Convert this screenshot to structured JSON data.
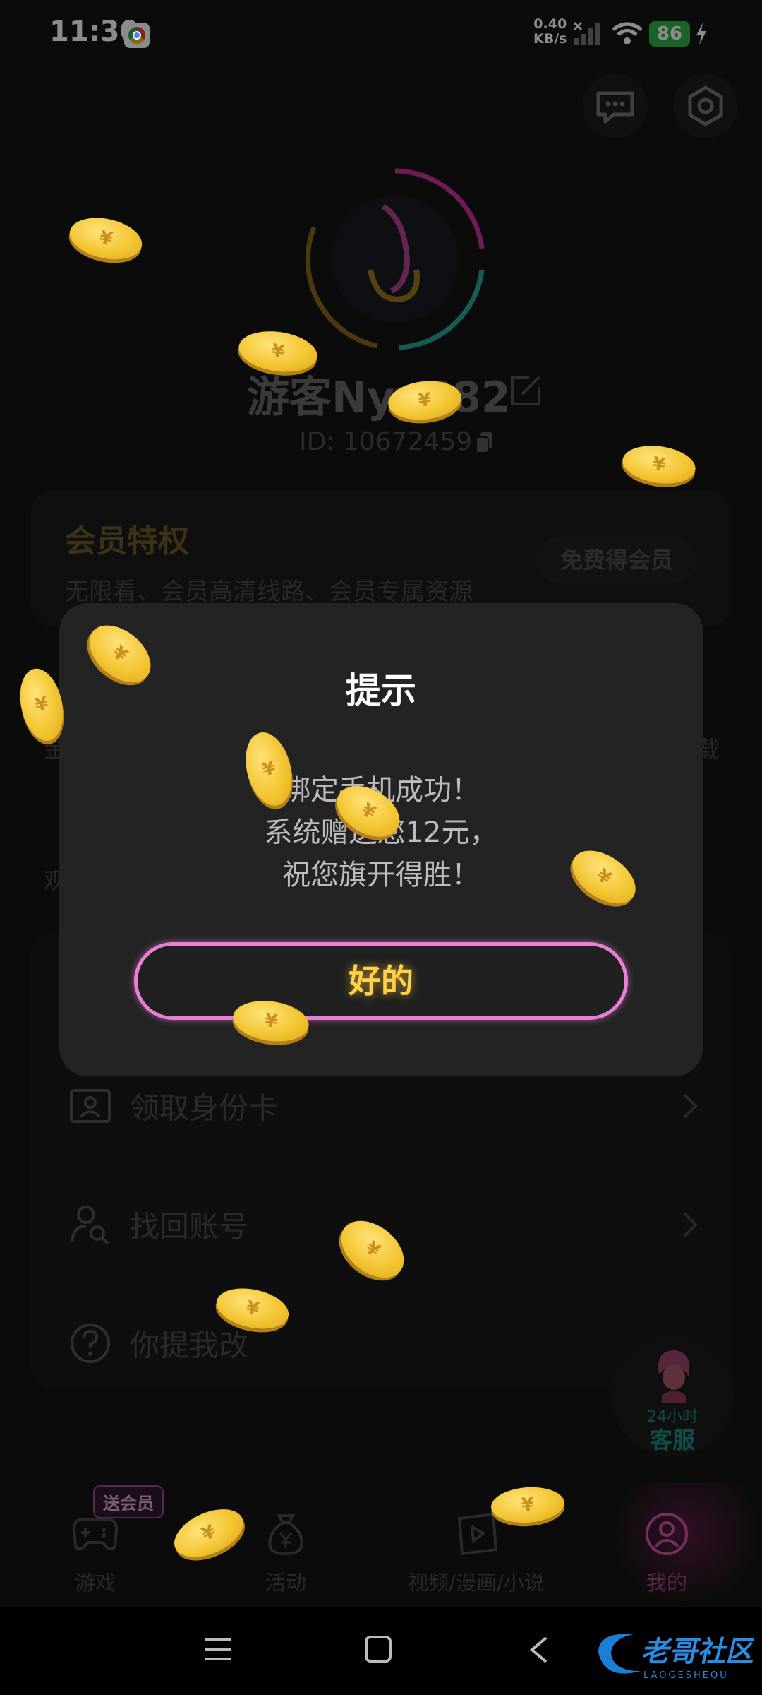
{
  "status_bar": {
    "time": "11:30",
    "net_speed_value": "0.40",
    "net_speed_unit": "KB/s",
    "battery": "86"
  },
  "profile": {
    "username": "游客Nyy682",
    "user_id": "ID: 10672459"
  },
  "vip": {
    "title": "会员特权",
    "description": "无限看、会员高清线路、会员专属资源",
    "button": "免费得会员"
  },
  "row_edge": {
    "left_1": "金",
    "right_1": "载",
    "left_2": "观"
  },
  "menu": {
    "items": [
      {
        "label": "领取身份卡"
      },
      {
        "label": "找回账号"
      },
      {
        "label": "你提我改"
      }
    ]
  },
  "service": {
    "hours": "24小时",
    "label": "客服"
  },
  "bottom_nav": {
    "badge": "送会员",
    "items": [
      {
        "label": "游戏"
      },
      {
        "label": "活动"
      },
      {
        "label": "视频/漫画/小说"
      },
      {
        "label": "我的"
      }
    ]
  },
  "dialog": {
    "title": "提示",
    "lines": [
      "绑定手机成功！",
      "系统赠送您12元，",
      "祝您旗开得胜！"
    ],
    "ok_button": "好的"
  },
  "colors": {
    "accent_pink": "#ea7fd6",
    "accent_gold": "#ffd24a",
    "battery_green": "#2fb44a"
  },
  "watermark": {
    "text": "老哥社区",
    "subtext": "LAOGESHEQU"
  }
}
